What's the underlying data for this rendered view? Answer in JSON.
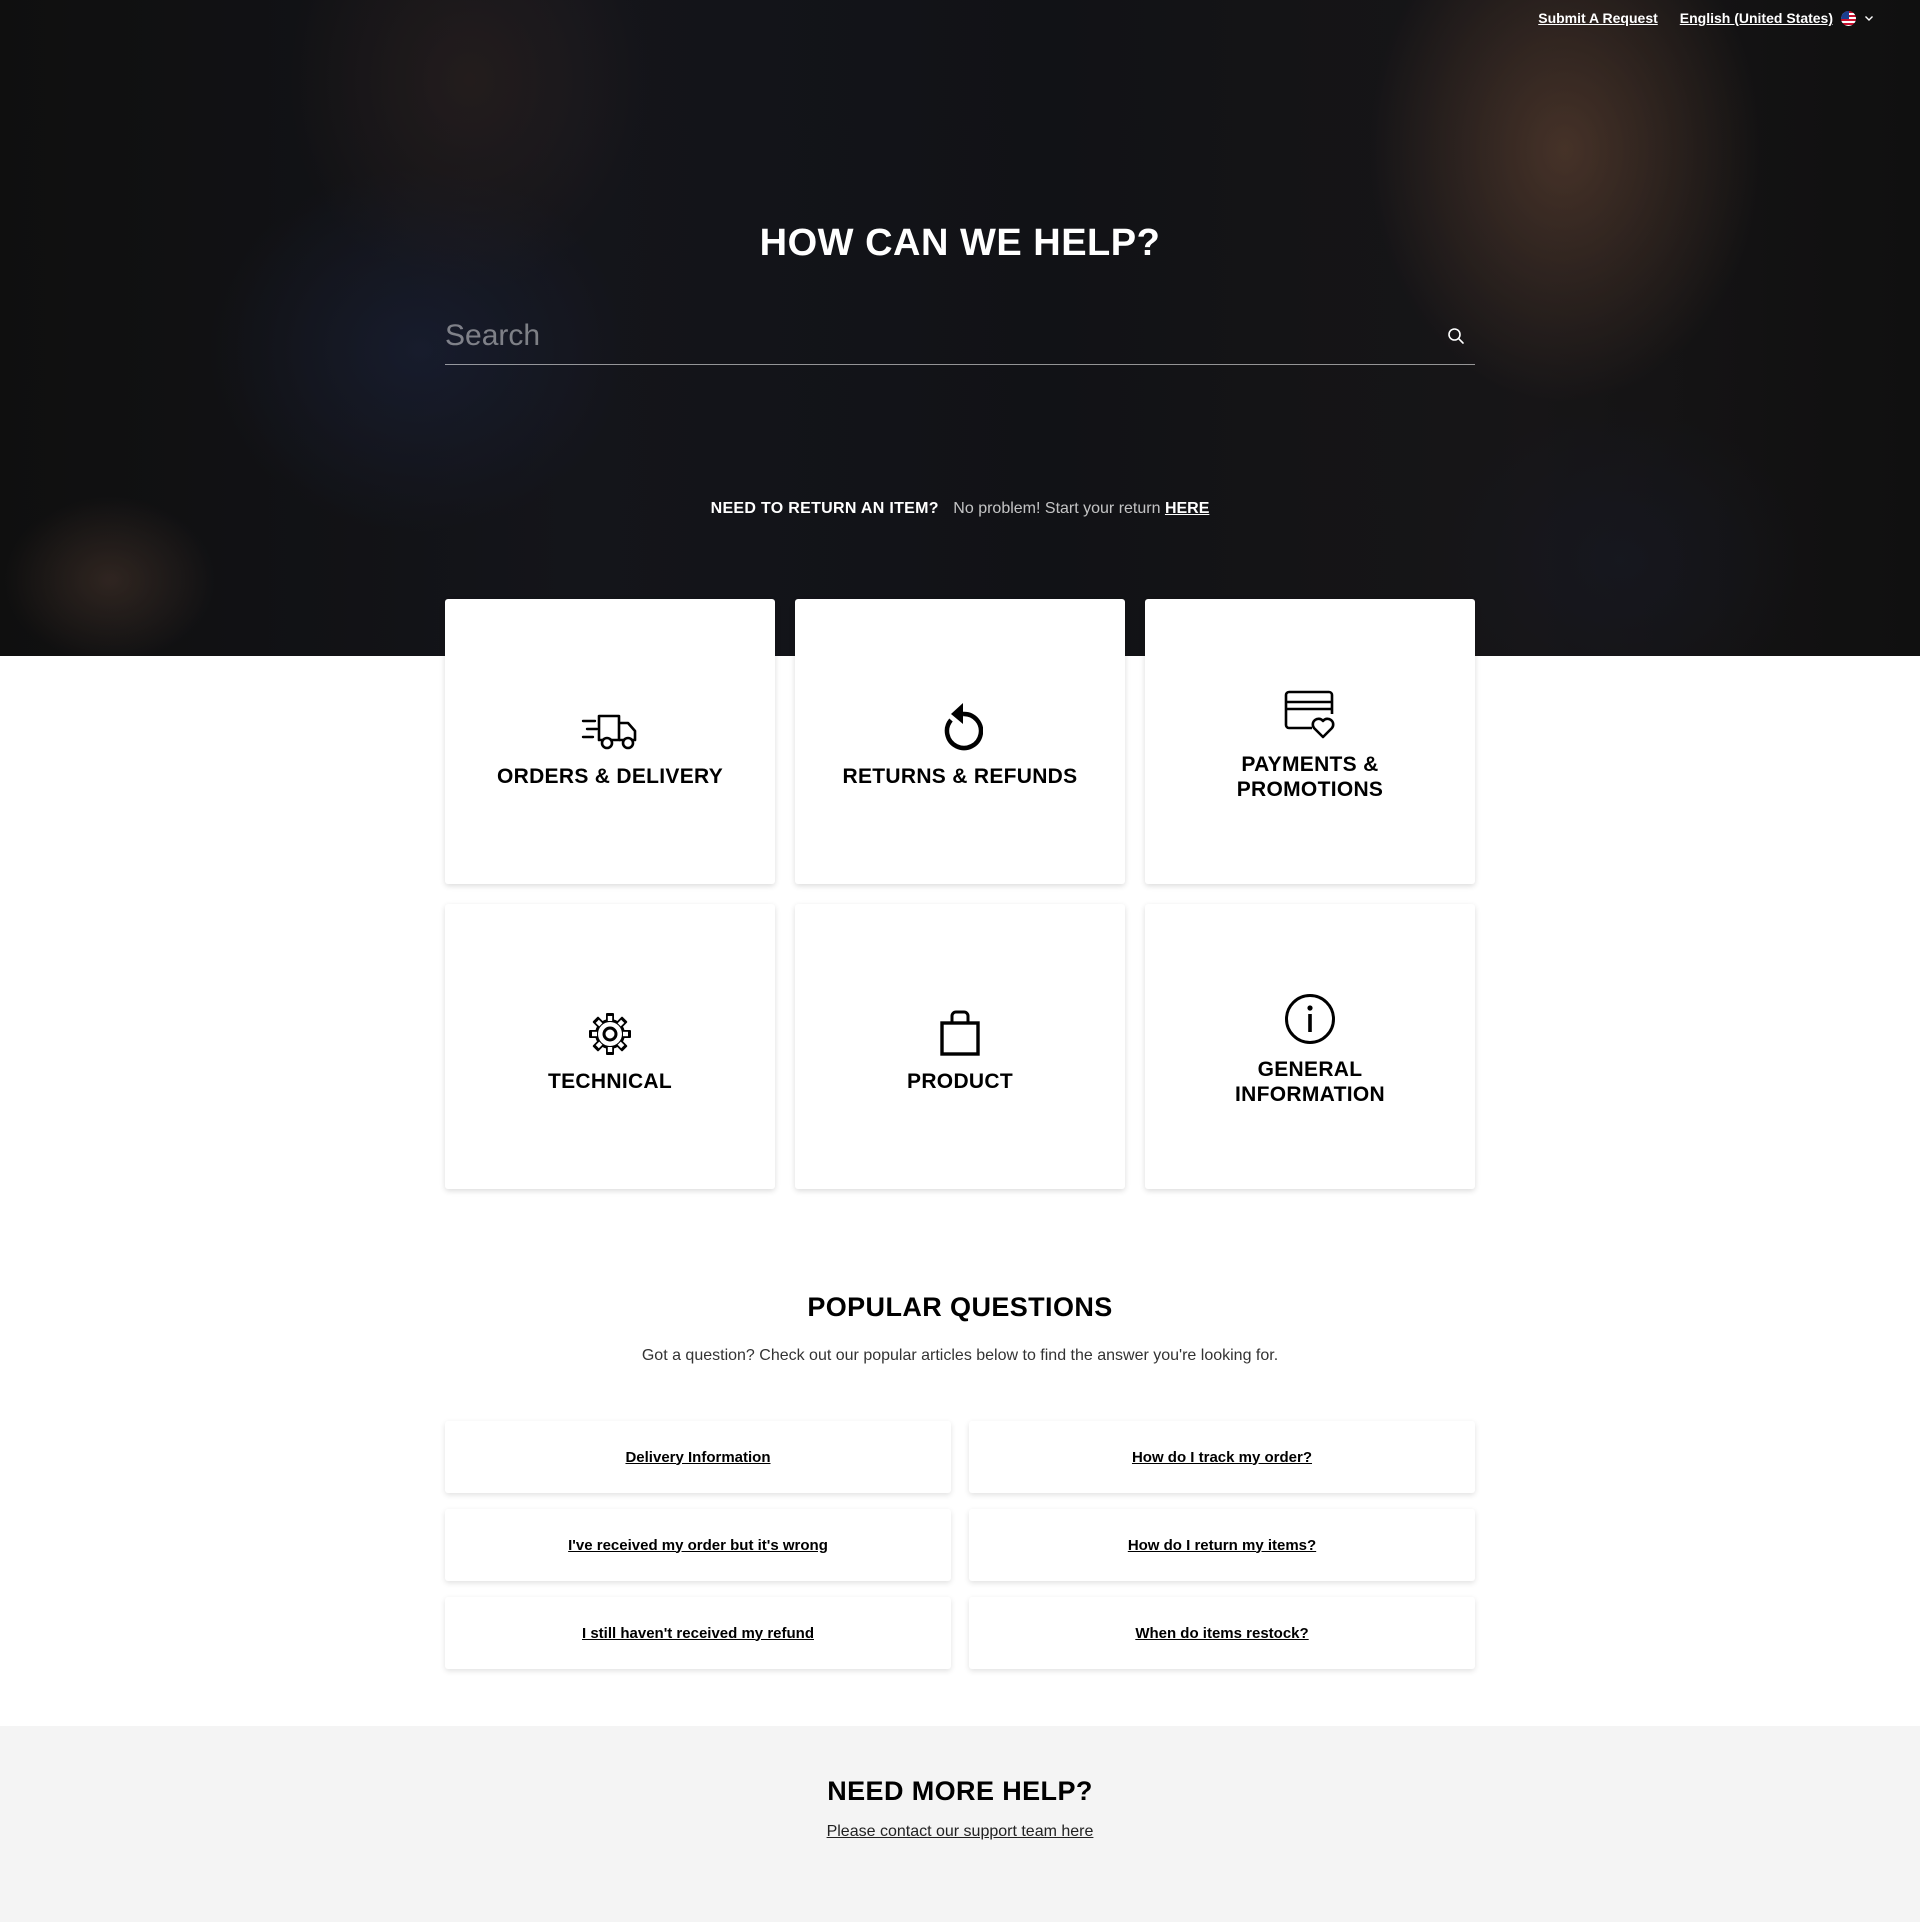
{
  "topnav": {
    "submit_request": "Submit A Request",
    "language": "English (United States)",
    "flag_icon": "us-flag-icon",
    "chevron_icon": "chevron-down-icon"
  },
  "hero": {
    "title": "HOW CAN WE HELP?",
    "search_placeholder": "Search",
    "search_icon": "search-icon",
    "return_strong": "NEED TO RETURN AN ITEM?",
    "return_text": "No problem! Start your return ",
    "return_link": "HERE"
  },
  "categories": [
    {
      "label": "ORDERS & DELIVERY",
      "icon": "delivery-truck-icon"
    },
    {
      "label": "RETURNS & REFUNDS",
      "icon": "return-arrow-icon"
    },
    {
      "label": "PAYMENTS & PROMOTIONS",
      "icon": "credit-card-heart-icon"
    },
    {
      "label": "TECHNICAL",
      "icon": "gear-icon"
    },
    {
      "label": "PRODUCT",
      "icon": "shopping-bag-icon"
    },
    {
      "label": "GENERAL INFORMATION",
      "icon": "info-icon"
    }
  ],
  "popular": {
    "title": "POPULAR QUESTIONS",
    "subtitle": "Got a question? Check out our popular articles below to find the answer you're looking for.",
    "items": [
      "Delivery Information",
      "How do I track my order?",
      "I've received my order but it's wrong",
      "How do I return my items?",
      "I still haven't received my refund",
      "When do items restock?"
    ]
  },
  "help": {
    "title": "NEED MORE HELP?",
    "link": "Please contact our support team here"
  },
  "colors": {
    "hero_overlay": "#141414",
    "text": "#000000",
    "footer_bg": "#f4f4f4"
  }
}
